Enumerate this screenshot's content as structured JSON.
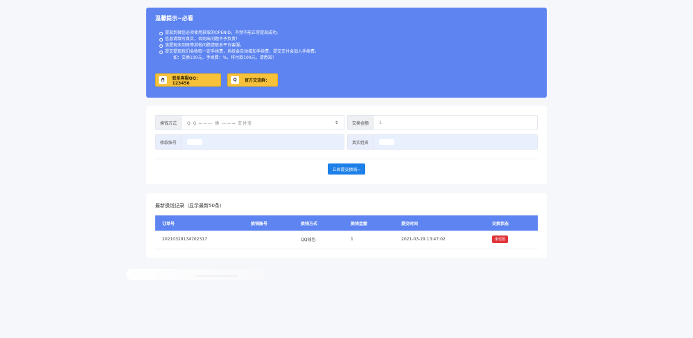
{
  "notice": {
    "title": "温馨提示~必看",
    "items": [
      "提现到微信必须使用获取的OPENID，不然不能正常提现成功。",
      "信息请填写真实，否则出问题不予负责！",
      "该提现未到账等其他问题请联系平台客服。",
      "提交提现我们会收取一定手续费，系统会自动增加手续费，提交支付会加入手续费。"
    ],
    "sub_item": "如：交换100元，手续费：%，将付款100元，请悉知！",
    "qq_button": "联系客服QQ：123456",
    "group_button": "官方交流群：",
    "qq_icon": "penguin-icon",
    "group_icon": "q-icon"
  },
  "form": {
    "method_label": "换钱方式",
    "method_value": "Q Q     ←—— 换 ——→     支付宝",
    "amount_label": "交换金额",
    "amount_value": "1",
    "account_label": "收款账号",
    "name_label": "真实姓名",
    "submit_label": "立即提交换钱~"
  },
  "records": {
    "title": "最新换钱记录（显示最新50条）",
    "columns": [
      "订单号",
      "换钱账号",
      "换钱方式",
      "换钱金额",
      "提交时间",
      "交换状态"
    ],
    "rows": [
      {
        "order": "20210329134702317",
        "account": "",
        "method": "QQ钱包",
        "amount": "1",
        "time": "2021-03-29 13:47:02",
        "status": "未付款"
      }
    ]
  },
  "colors": {
    "primary": "#5d84f0",
    "button_yellow": "#f7c23a",
    "submit_blue": "#1d7fe8",
    "badge_red": "#e0353b"
  }
}
